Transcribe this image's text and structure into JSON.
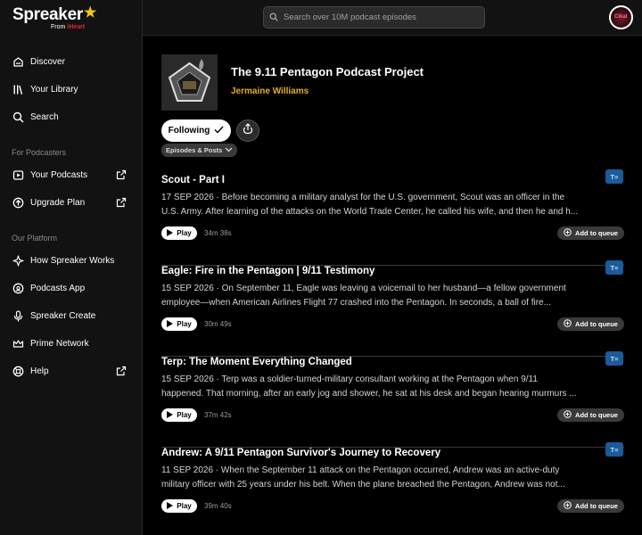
{
  "brand": {
    "name": "Spreaker",
    "sub_prefix": "From",
    "sub_brand": "iHeart"
  },
  "sidebar": {
    "main": [
      {
        "label": "Discover",
        "icon": "discover-icon"
      },
      {
        "label": "Your Library",
        "icon": "library-icon"
      },
      {
        "label": "Search",
        "icon": "search-icon"
      }
    ],
    "podcasters_title": "For Podcasters",
    "podcasters": [
      {
        "label": "Your Podcasts",
        "icon": "podcasts-icon",
        "external": true
      },
      {
        "label": "Upgrade Plan",
        "icon": "upgrade-icon",
        "external": true
      }
    ],
    "platform_title": "Our Platform",
    "platform": [
      {
        "label": "How Spreaker Works",
        "icon": "sparkle-icon"
      },
      {
        "label": "Podcasts App",
        "icon": "app-icon"
      },
      {
        "label": "Spreaker Create",
        "icon": "microphone-icon"
      },
      {
        "label": "Prime Network",
        "icon": "crown-icon"
      },
      {
        "label": "Help",
        "icon": "help-icon",
        "external": true
      }
    ]
  },
  "search": {
    "placeholder": "Search over 10M podcast episodes"
  },
  "podcast": {
    "title": "The 9.11 Pentagon Podcast Project",
    "author": "Jermaine Williams",
    "follow_label": "Following",
    "filter_label": "Episodes & Posts"
  },
  "episodes": [
    {
      "title": "Scout - Part I",
      "desc_line1": "17 SEP 2026 · Before becoming a military analyst for the U.S. government, Scout was an officer in the",
      "desc_line2": "U.S. Army. After learning of the attacks on the World Trade Center, he called his wife, and then he and h...",
      "duration": "34m 38s"
    },
    {
      "title": "Eagle: Fire in the Pentagon | 9/11 Testimony",
      "desc_line1": "15 SEP 2026 · On September 11, Eagle was leaving a voicemail to her husband—a fellow government",
      "desc_line2": "employee—when American Airlines Flight 77 crashed into the Pentagon. In seconds, a ball of fire...",
      "duration": "30m 49s"
    },
    {
      "title": "Terp: The Moment Everything Changed",
      "desc_line1": "15 SEP 2026 · Terp was a soldier-turned-military consultant working at the Pentagon when 9/11",
      "desc_line2": "happened. That morning, after an early jog and shower, he sat at his desk and began hearing murmurs ...",
      "duration": "37m 42s"
    },
    {
      "title": "Andrew: A 9/11 Pentagon Survivor's Journey to Recovery",
      "desc_line1": "11 SEP 2026 · When the September 11 attack on the Pentagon occurred, Andrew was an active-duty",
      "desc_line2": "military officer with 25 years under his belt. When the plane breached the Pentagon, Andrew was not...",
      "duration": "39m 40s"
    }
  ],
  "labels": {
    "play": "Play",
    "queue": "Add to queue",
    "transcript_badge": "T≡"
  },
  "avatar": {
    "text": "Cikal"
  }
}
